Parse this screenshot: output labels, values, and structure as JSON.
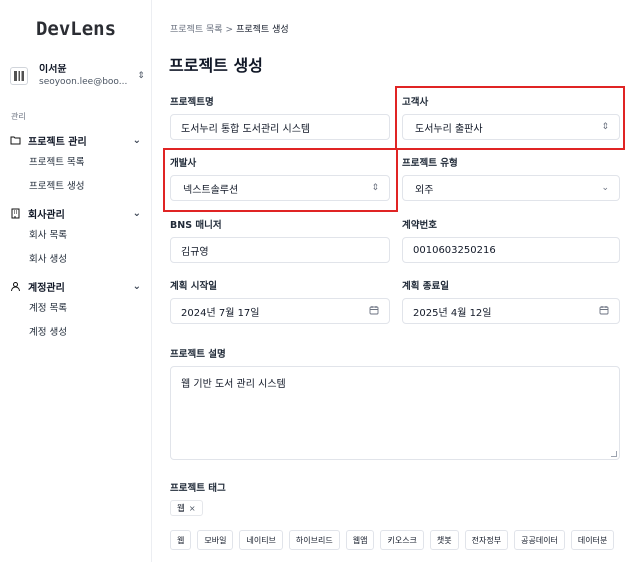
{
  "sidebar": {
    "logo": "DevLens",
    "user": {
      "name": "이서윤",
      "email": "seoyoon.lee@boo..."
    },
    "section_label": "관리",
    "groups": [
      {
        "label": "프로젝트 관리",
        "icon": "folder-icon",
        "items": [
          "프로젝트 목록",
          "프로젝트 생성"
        ]
      },
      {
        "label": "회사관리",
        "icon": "building-icon",
        "items": [
          "회사 목록",
          "회사 생성"
        ]
      },
      {
        "label": "계정관리",
        "icon": "user-icon",
        "items": [
          "계정 목록",
          "계정 생성"
        ]
      }
    ]
  },
  "breadcrumb": {
    "parent": "프로젝트 목록",
    "separator": ">",
    "current": "프로젝트 생성"
  },
  "page_title": "프로젝트 생성",
  "form": {
    "project_name": {
      "label": "프로젝트명",
      "value": "도서누리 통합 도서관리 시스템"
    },
    "client": {
      "label": "고객사",
      "value": "도서누리 출판사"
    },
    "developer": {
      "label": "개발사",
      "value": "넥스트솔루션"
    },
    "project_type": {
      "label": "프로젝트 유형",
      "value": "외주"
    },
    "bns_manager": {
      "label": "BNS 매니저",
      "value": "김규영"
    },
    "contract_no": {
      "label": "계약번호",
      "value": "0010603250216"
    },
    "start_date": {
      "label": "계획 시작일",
      "value": "2024년 7월 17일"
    },
    "end_date": {
      "label": "계획 종료일",
      "value": "2025년 4월 12일"
    },
    "description": {
      "label": "프로젝트 설명",
      "value": "웹 기반 도서 관리 시스템"
    },
    "tags": {
      "label": "프로젝트 태그",
      "selected": [
        "웹"
      ],
      "options": [
        "웹",
        "모바일",
        "네이티브",
        "하이브리드",
        "웹앱",
        "키오스크",
        "챗봇",
        "전자정부",
        "공공데이터",
        "데이터분"
      ]
    }
  },
  "colors": {
    "highlight": "#e02424",
    "border": "#e1e4ea"
  }
}
